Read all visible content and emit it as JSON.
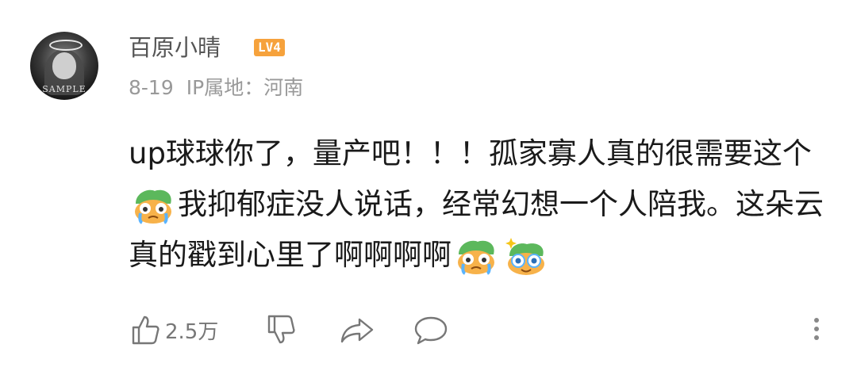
{
  "comment": {
    "user": {
      "name": "百原小晴",
      "level": "LV4",
      "avatar_caption": "SAMPLE"
    },
    "meta": {
      "date": "8-19",
      "ip_location": "IP属地：河南"
    },
    "text": {
      "seg1": "up球球你了，量产吧！！！孤家寡人真的很需要这个",
      "seg2": "我抑郁症没人说话，经常幻想一个人陪我。这朵云真的戳到心里了啊啊啊啊"
    },
    "emojis": [
      "crying-emoji",
      "crying-emoji",
      "sparkle-eyes-emoji"
    ],
    "actions": {
      "like_count": "2.5万",
      "icons": [
        "thumbs-up-icon",
        "thumbs-down-icon",
        "share-icon",
        "reply-icon",
        "more-icon"
      ]
    }
  },
  "colors": {
    "level_badge": "#f6a23c",
    "text_primary": "#1a1a1a",
    "text_secondary": "#999999",
    "username": "#555555"
  }
}
